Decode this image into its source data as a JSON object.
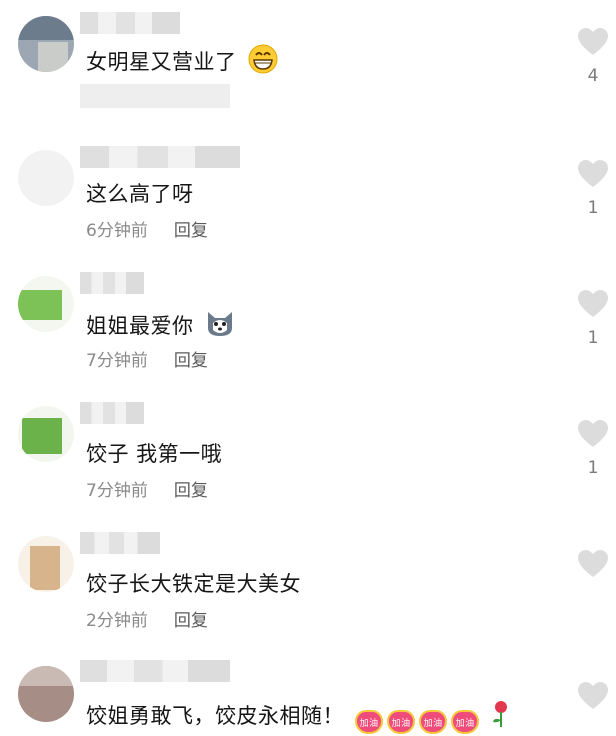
{
  "comments": [
    {
      "text": "女明星又营业了",
      "time": "",
      "reply": "",
      "likes": "4",
      "emoji": "grinning-face-icon"
    },
    {
      "text": "这么高了呀",
      "time": "6分钟前",
      "reply": "回复",
      "likes": "1"
    },
    {
      "text": "姐姐最爱你",
      "time": "7分钟前",
      "reply": "回复",
      "likes": "1",
      "emoji": "husky-face-icon"
    },
    {
      "text": "饺子 我第一哦",
      "time": "7分钟前",
      "reply": "回复",
      "likes": "1"
    },
    {
      "text": "饺子长大铁定是大美女",
      "time": "2分钟前",
      "reply": "回复",
      "likes": ""
    },
    {
      "text": "饺姐勇敢飞，饺皮永相随！",
      "time": "",
      "reply": "",
      "likes": "",
      "stickers": [
        "加油",
        "加油",
        "加油",
        "加油"
      ],
      "emoji": "rose-icon"
    }
  ],
  "colors": {
    "like_heart": "#dcdcdc",
    "text": "#161616",
    "meta": "#8a8a8a"
  }
}
